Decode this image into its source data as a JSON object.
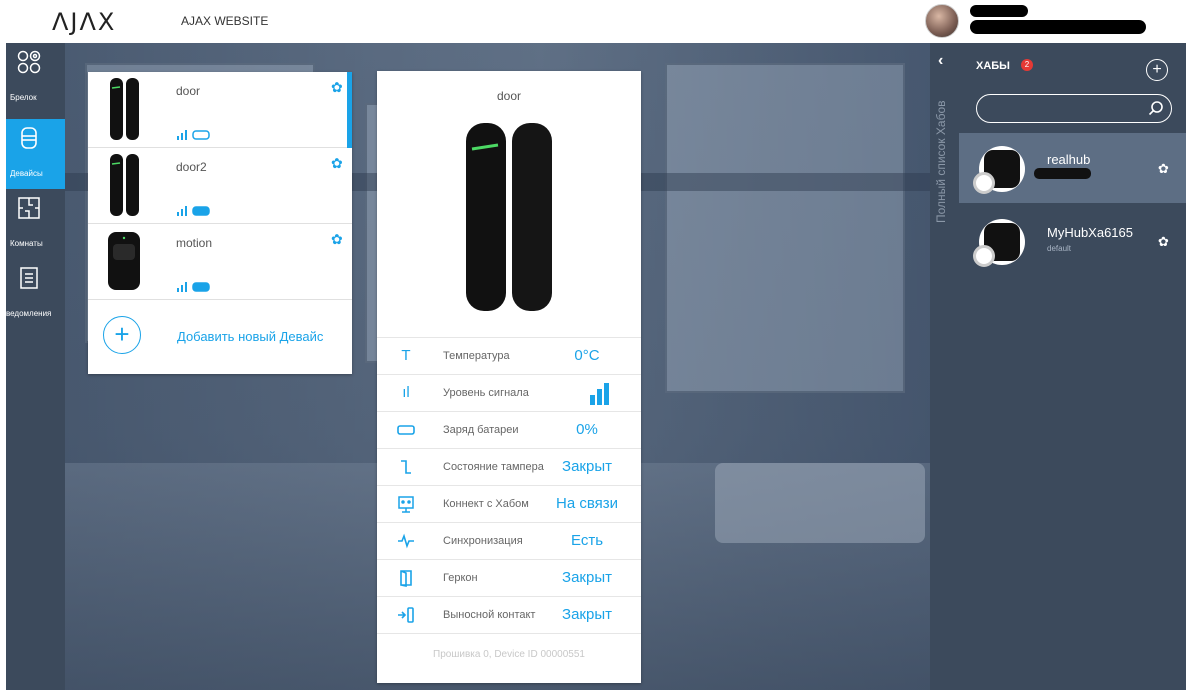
{
  "topbar": {
    "logo": "ΛJΛX",
    "website_link": "AJAX WEBSITE"
  },
  "leftnav": {
    "items": [
      {
        "label": "Брелок",
        "icon": "keyfob-icon"
      },
      {
        "label": "Девайсы",
        "icon": "device-icon",
        "active": true
      },
      {
        "label": "Комнаты",
        "icon": "rooms-icon"
      },
      {
        "label": "ведомления",
        "icon": "notifications-icon"
      }
    ]
  },
  "devices": {
    "list": [
      {
        "name": "door",
        "selected": true
      },
      {
        "name": "door2"
      },
      {
        "name": "motion"
      }
    ],
    "add_label": "Добавить новый Девайс",
    "add_symbol": "+"
  },
  "detail": {
    "title": "door",
    "properties": [
      {
        "label": "Температура",
        "value": "0°C",
        "icon": "thermometer-icon"
      },
      {
        "label": "Уровень сигнала",
        "value": "",
        "icon": "signal-icon"
      },
      {
        "label": "Заряд батареи",
        "value": "0%",
        "icon": "battery-icon"
      },
      {
        "label": "Состояние тампера",
        "value": "Закрыт",
        "icon": "tamper-icon"
      },
      {
        "label": "Коннект с Хабом",
        "value": "На связи",
        "icon": "hub-connection-icon"
      },
      {
        "label": "Синхронизация",
        "value": "Есть",
        "icon": "sync-icon"
      },
      {
        "label": "Геркон",
        "value": "Закрыт",
        "icon": "reed-switch-icon"
      },
      {
        "label": "Выносной контакт",
        "value": "Закрыт",
        "icon": "external-contact-icon"
      }
    ],
    "footer": "Прошивка 0, Device ID 00000551"
  },
  "strip": {
    "collapse_symbol": "‹",
    "vertical_label": "Полный список Хабов"
  },
  "hubs": {
    "title": "ХАБЫ",
    "badge_count": "2",
    "add_symbol": "+",
    "items": [
      {
        "name": "realhub",
        "sub": "",
        "selected": true
      },
      {
        "name": "MyHubXa6165",
        "sub": "default"
      }
    ]
  },
  "colors": {
    "accent": "#1aa3e8",
    "sidebar_bg": "#3c4a5c",
    "badge": "#e53935"
  }
}
